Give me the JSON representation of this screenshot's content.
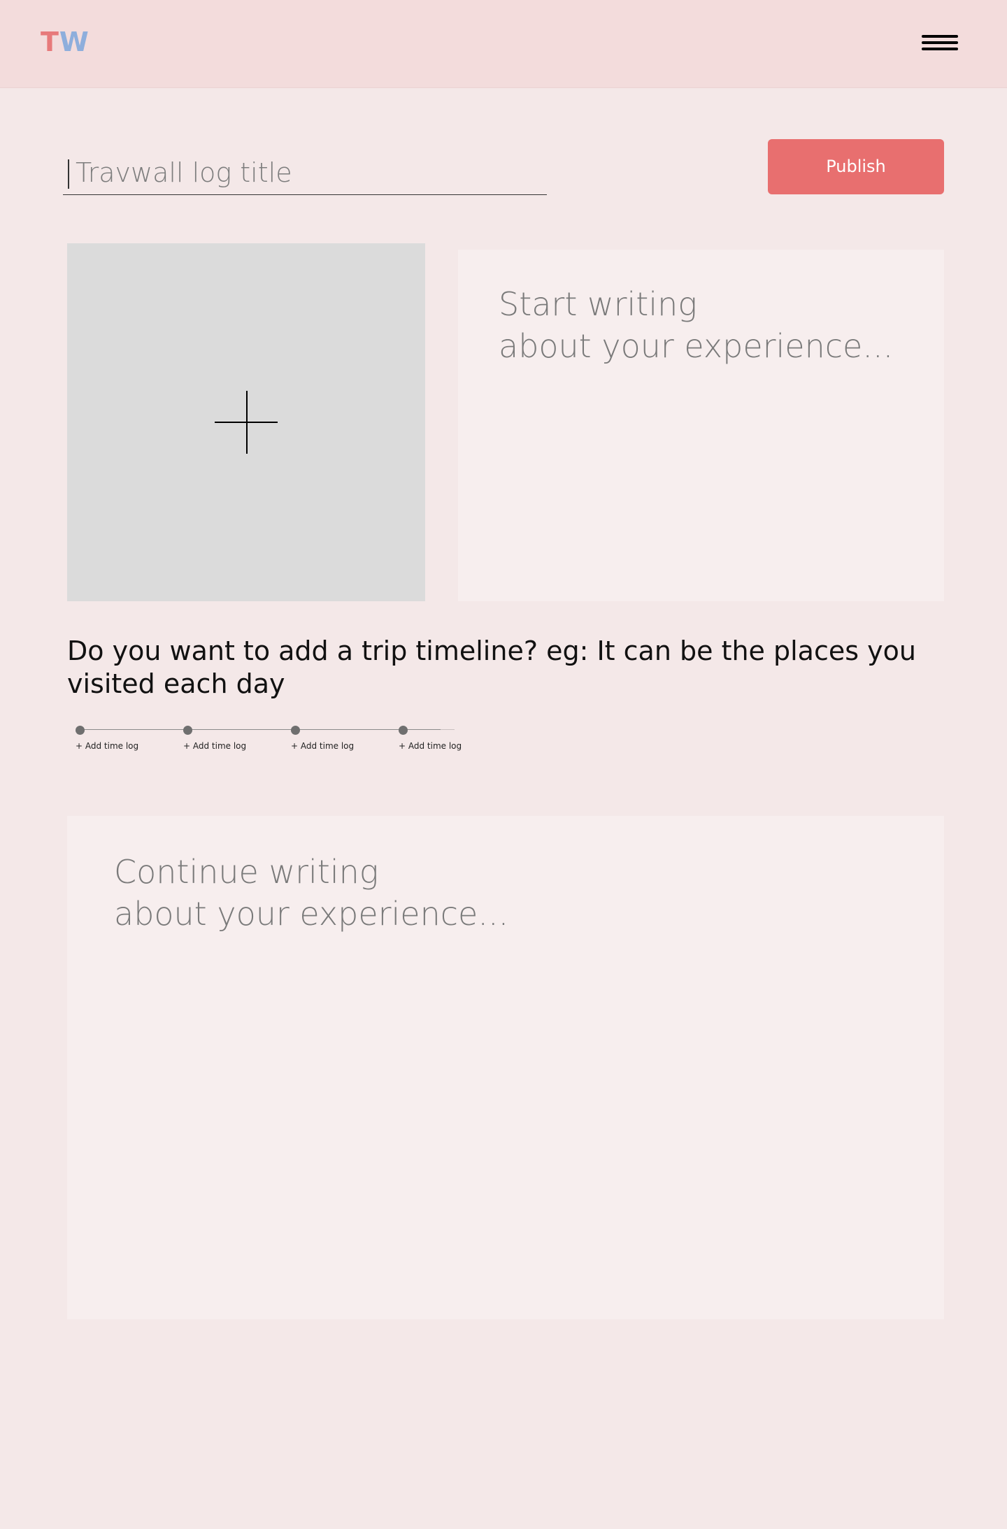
{
  "header": {
    "logo_first": "T",
    "logo_second": "W",
    "menu_icon": "hamburger-menu-icon"
  },
  "form": {
    "title_placeholder": "Travwall log title",
    "publish_label": "Publish",
    "image_upload_icon": "plus-icon",
    "intro_placeholder": "Start writing\nabout your experience...",
    "timeline_question": "Do you want to add a trip timeline? eg: It can be the places you visited each day",
    "timeline_items": [
      {
        "label": "+ Add time log"
      },
      {
        "label": "+ Add time log"
      },
      {
        "label": "+ Add time log"
      },
      {
        "label": "+ Add time log"
      }
    ],
    "continue_placeholder": "Continue writing\nabout your experience..."
  },
  "colors": {
    "page_background": "#f4e8e8",
    "header_background": "#f3dcdc",
    "accent_red": "#e86f6f",
    "logo_red": "#e77a7b",
    "logo_blue": "#8eaedc"
  }
}
